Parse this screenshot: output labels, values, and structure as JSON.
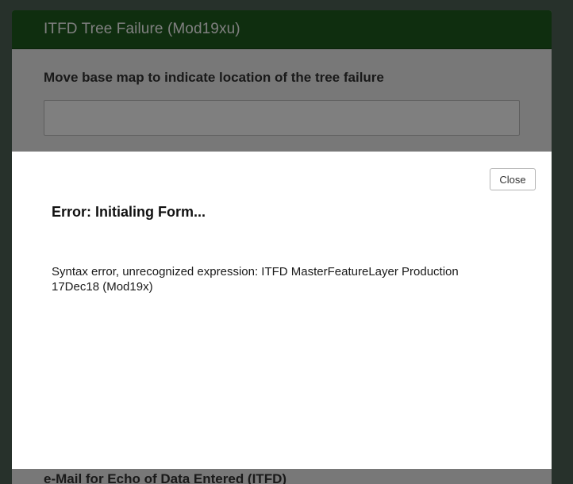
{
  "form": {
    "title": "ITFD Tree Failure (Mod19xu)",
    "question_label": "Move base map to indicate location of the tree failure",
    "question_value": "",
    "next_question_label": "e-Mail for Echo of Data Entered (ITFD)"
  },
  "dialog": {
    "close_label": "Close",
    "title": "Error: Initialing Form...",
    "message": "Syntax error, unrecognized expression: ITFD MasterFeatureLayer Production 17Dec18 (Mod19x)"
  },
  "colors": {
    "header": "#1f5c1f",
    "page_background": "#4f6357",
    "dialog_background": "#ffffff"
  }
}
